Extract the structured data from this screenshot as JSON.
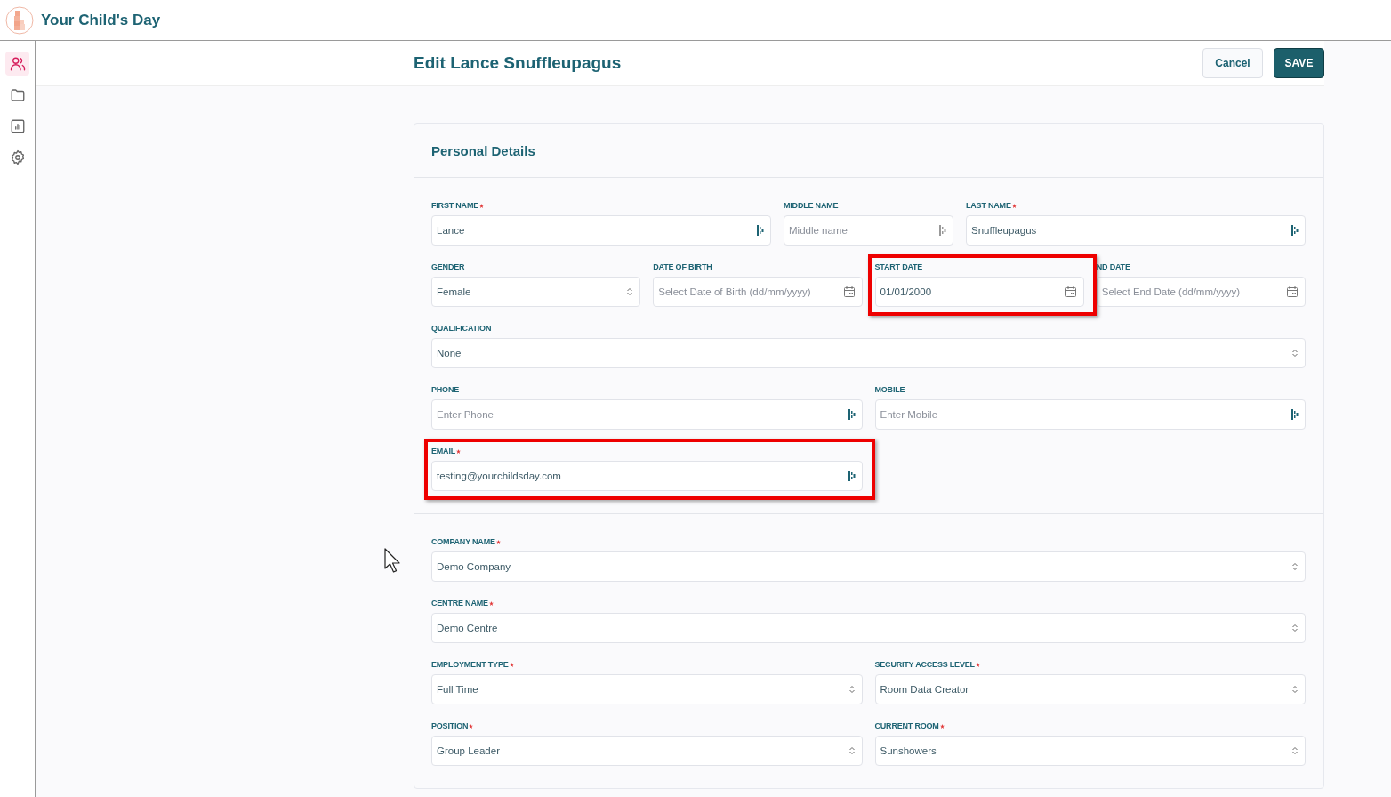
{
  "app": {
    "title": "Your Child's Day"
  },
  "sidebar": {
    "items": [
      {
        "kind": "people",
        "selected": true
      },
      {
        "kind": "folder",
        "selected": false
      },
      {
        "kind": "report",
        "selected": false
      },
      {
        "kind": "settings",
        "selected": false
      }
    ]
  },
  "page": {
    "title": "Edit Lance Snuffleupagus",
    "buttons": [
      {
        "label": "Cancel",
        "kind": "secondary"
      },
      {
        "label": "SAVE",
        "kind": "primary"
      }
    ]
  },
  "form": {
    "title": "Personal Details",
    "sections": [
      {
        "rows": [
          {
            "fields": [
              {
                "label": "FIRST NAME",
                "required": true,
                "kind": "text",
                "value": "Lance",
                "highlighted": false
              },
              {
                "label": "MIDDLE NAME",
                "required": false,
                "kind": "text",
                "placeholder": "Middle name",
                "highlighted": false
              },
              {
                "label": "LAST NAME",
                "required": true,
                "kind": "text",
                "value": "Snuffleupagus",
                "highlighted": false
              }
            ]
          },
          {
            "fields": [
              {
                "label": "GENDER",
                "required": false,
                "kind": "select",
                "value": "Female",
                "highlighted": false
              },
              {
                "label": "DATE OF BIRTH",
                "required": false,
                "kind": "date",
                "placeholder": "Select Date of Birth (dd/mm/yyyy)",
                "highlighted": false
              },
              {
                "label": "START DATE",
                "required": false,
                "kind": "date",
                "value": "01/01/2000",
                "highlighted": true
              },
              {
                "label": "ND DATE",
                "required": false,
                "kind": "date",
                "placeholder": "Select End Date (dd/mm/yyyy)",
                "highlighted": false
              }
            ]
          },
          {
            "fields": [
              {
                "label": "QUALIFICATION",
                "required": false,
                "kind": "select",
                "value": "None",
                "highlighted": false
              }
            ]
          },
          {
            "fields": [
              {
                "label": "PHONE",
                "required": false,
                "kind": "text",
                "placeholder": "Enter Phone",
                "highlighted": false
              },
              {
                "label": "MOBILE",
                "required": false,
                "kind": "text",
                "placeholder": "Enter Mobile",
                "highlighted": false
              }
            ]
          },
          {
            "fields": [
              {
                "label": "EMAIL",
                "required": true,
                "kind": "text",
                "value": "testing@yourchildsday.com",
                "highlighted": true
              }
            ]
          }
        ]
      },
      {
        "rows": [
          {
            "fields": [
              {
                "label": "COMPANY NAME",
                "required": true,
                "kind": "select",
                "value": "Demo Company",
                "highlighted": false
              }
            ]
          },
          {
            "fields": [
              {
                "label": "CENTRE NAME",
                "required": true,
                "kind": "select",
                "value": "Demo Centre",
                "highlighted": false
              }
            ]
          },
          {
            "fields": [
              {
                "label": "EMPLOYMENT TYPE",
                "required": true,
                "kind": "select",
                "value": "Full Time",
                "highlighted": false
              },
              {
                "label": "SECURITY ACCESS LEVEL",
                "required": true,
                "kind": "select",
                "value": "Room Data Creator",
                "highlighted": false
              }
            ]
          },
          {
            "fields": [
              {
                "label": "POSITION",
                "required": true,
                "kind": "select",
                "value": "Group Leader",
                "highlighted": false
              },
              {
                "label": "CURRENT ROOM",
                "required": true,
                "kind": "select",
                "value": "Sunshowers",
                "highlighted": false
              }
            ]
          }
        ]
      }
    ]
  }
}
